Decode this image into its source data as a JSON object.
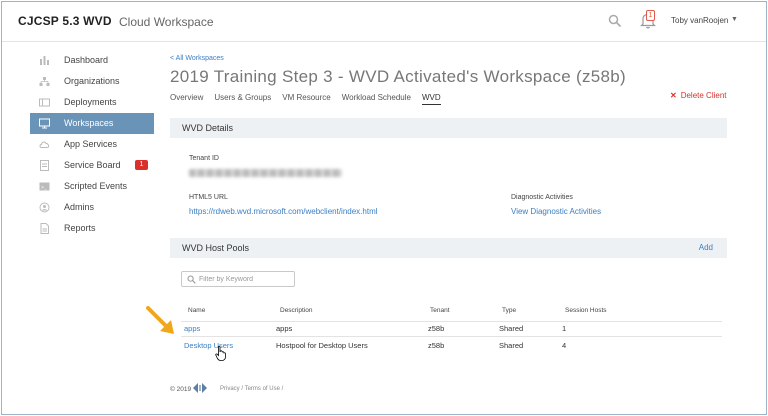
{
  "app": {
    "brand": "CJCSP 5.3 WVD",
    "subtitle": "Cloud Workspace"
  },
  "header": {
    "notification_count": "1",
    "user_name": "Toby vanRoojen",
    "user_caret": "▼"
  },
  "sidebar": {
    "items": [
      {
        "label": "Dashboard",
        "icon": "dashboard-icon"
      },
      {
        "label": "Organizations",
        "icon": "org-icon"
      },
      {
        "label": "Deployments",
        "icon": "deployments-icon"
      },
      {
        "label": "Workspaces",
        "icon": "monitor-icon",
        "active": true
      },
      {
        "label": "App Services",
        "icon": "cloud-icon"
      },
      {
        "label": "Service Board",
        "icon": "board-icon",
        "badge": "1"
      },
      {
        "label": "Scripted Events",
        "icon": "script-icon"
      },
      {
        "label": "Admins",
        "icon": "admin-icon"
      },
      {
        "label": "Reports",
        "icon": "report-icon"
      }
    ]
  },
  "main": {
    "breadcrumb": "< All Workspaces",
    "title": "2019 Training Step 3 - WVD Activated's Workspace (z58b)",
    "tabs": [
      "Overview",
      "Users & Groups",
      "VM Resource",
      "Workload Schedule",
      "WVD"
    ],
    "active_tab": "WVD",
    "delete_label": "Delete Client",
    "delete_symbol": "✕"
  },
  "wvd_details": {
    "heading": "WVD Details",
    "tenant_id_label": "Tenant ID",
    "html5_label": "HTML5 URL",
    "html5_url": "https://rdweb.wvd.microsoft.com/webclient/index.html",
    "diag_label": "Diagnostic Activities",
    "diag_link": "View Diagnostic Activities"
  },
  "host_pools": {
    "heading": "WVD Host Pools",
    "add_label": "Add",
    "filter_placeholder": "Filter by Keyword",
    "columns": [
      "Name",
      "Description",
      "Tenant",
      "Type",
      "Session Hosts"
    ],
    "rows": [
      {
        "name": "apps",
        "description": "apps",
        "tenant": "z58b",
        "type": "Shared",
        "session_hosts": "1"
      },
      {
        "name": "Desktop Users",
        "description": "Hostpool for Desktop Users",
        "tenant": "z58b",
        "type": "Shared",
        "session_hosts": "4"
      }
    ]
  },
  "footer": {
    "copyright": "© 2019",
    "links": "Privacy  /  Terms of Use  /"
  },
  "colors": {
    "accent": "#3a7fc4",
    "active_nav": "#6a93b8",
    "danger": "#d9302c",
    "annotation_arrow": "#f0a71c"
  }
}
